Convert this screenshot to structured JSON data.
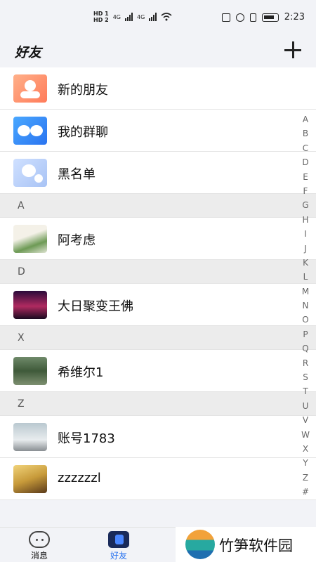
{
  "status": {
    "hd1": "HD 1",
    "hd2": "HD 2",
    "net1": "4G",
    "net2": "4G",
    "time": "2:23"
  },
  "header": {
    "title": "好友"
  },
  "fixed_items": [
    {
      "label": "新的朋友",
      "icon": "new-friend-icon"
    },
    {
      "label": "我的群聊",
      "icon": "group-chat-icon"
    },
    {
      "label": "黑名单",
      "icon": "blacklist-icon"
    }
  ],
  "sections": [
    {
      "letter": "A",
      "contacts": [
        {
          "name": "阿考虑"
        }
      ]
    },
    {
      "letter": "D",
      "contacts": [
        {
          "name": "大日聚变王佛"
        }
      ]
    },
    {
      "letter": "X",
      "contacts": [
        {
          "name": "希维尔1"
        }
      ]
    },
    {
      "letter": "Z",
      "contacts": [
        {
          "name": "账号1783"
        },
        {
          "name": "zzzzzzl"
        }
      ]
    }
  ],
  "index_letters": [
    "A",
    "B",
    "C",
    "D",
    "E",
    "F",
    "G",
    "H",
    "I",
    "J",
    "K",
    "L",
    "M",
    "N",
    "O",
    "P",
    "Q",
    "R",
    "S",
    "T",
    "U",
    "V",
    "W",
    "X",
    "Y",
    "Z",
    "#"
  ],
  "tabbar": {
    "messages": "消息",
    "friends": "好友",
    "active_color": "#2a74f0"
  },
  "watermark": {
    "text": "竹笋软件园"
  }
}
